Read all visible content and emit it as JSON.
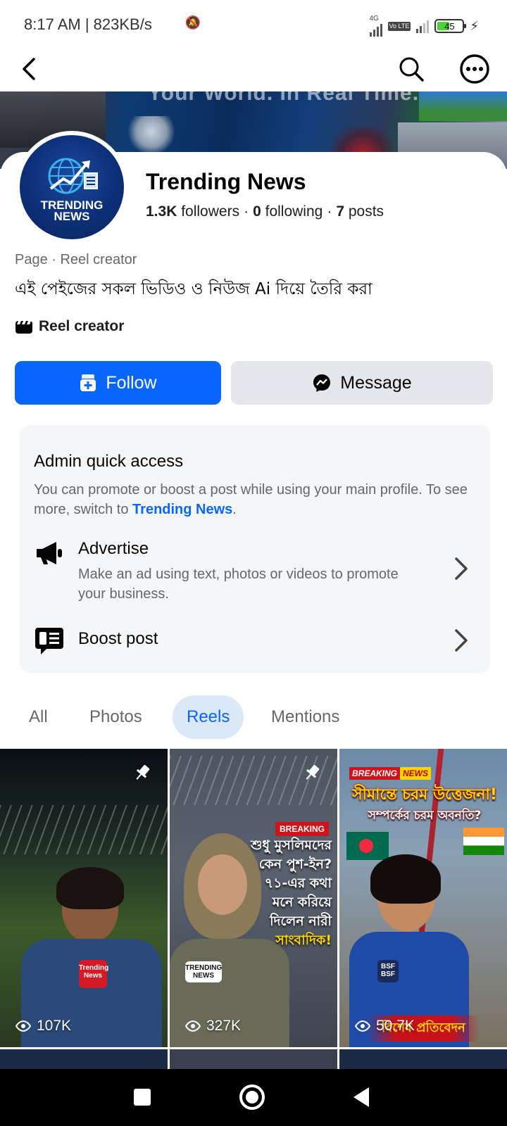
{
  "status_bar": {
    "time_speed": "8:17 AM | 823KB/s",
    "network": "4G",
    "volte": "Vo LTE",
    "battery": "45",
    "battery_level": 0.45
  },
  "top_nav": {
    "back_icon": "chevron-left-icon",
    "search_icon": "search-icon",
    "more_icon": "more-horizontal-circle-icon"
  },
  "cover": {
    "text": "Your World. In Real Time."
  },
  "profile": {
    "avatar_line1": "TRENDING",
    "avatar_line2": "NEWS",
    "name": "Trending News",
    "followers_count": "1.3K",
    "followers_label": "followers",
    "following_count": "0",
    "following_label": "following",
    "posts_count": "7",
    "posts_label": "posts",
    "category": "Page · Reel creator",
    "bio": "এই পেইজের সকল ভিডিও ও নিউজ Ai দিয়ে তৈরি করা",
    "tag_label": "Reel creator"
  },
  "actions": {
    "follow_label": "Follow",
    "message_label": "Message"
  },
  "admin": {
    "title": "Admin quick access",
    "desc_prefix": "You can promote or boost a post while using your main profile. To see more, switch to ",
    "desc_link": "Trending News",
    "desc_suffix": ".",
    "advertise_title": "Advertise",
    "advertise_sub": "Make an ad using text, photos or videos to promote your business.",
    "boost_title": "Boost post"
  },
  "tabs": {
    "all": "All",
    "photos": "Photos",
    "reels": "Reels",
    "mentions": "Mentions",
    "active": "Reels"
  },
  "reels": [
    {
      "views": "107K",
      "pinned": true,
      "mic_text": "Trending News"
    },
    {
      "views": "327K",
      "pinned": true,
      "badge": "BREAKING",
      "mic_text": "TRENDING NEWS",
      "line1": "শুধু মুসলিমদের",
      "line2": "কেন পুশ-ইন?",
      "line3": "৭১-এর কথা",
      "line4": "মনে করিয়ে",
      "line5": "দিলেন নারী",
      "line6": "সাংবাদিক!"
    },
    {
      "views": "50.7K",
      "pinned": false,
      "badge1": "BREAKING",
      "badge2": "NEWS",
      "mic_text": "BSF BSF",
      "headline1": "সীমান্তে চরম উত্তেজনা!",
      "headline2": "সম্পর্কের চরম অবনতি?",
      "footer": "বিশেষ প্রতিবেদন"
    }
  ],
  "colors": {
    "accent": "#0866ff",
    "secondary_button": "#e4e6eb",
    "admin_card": "#f5f6f8",
    "active_tab_bg": "#dbe8f8"
  }
}
